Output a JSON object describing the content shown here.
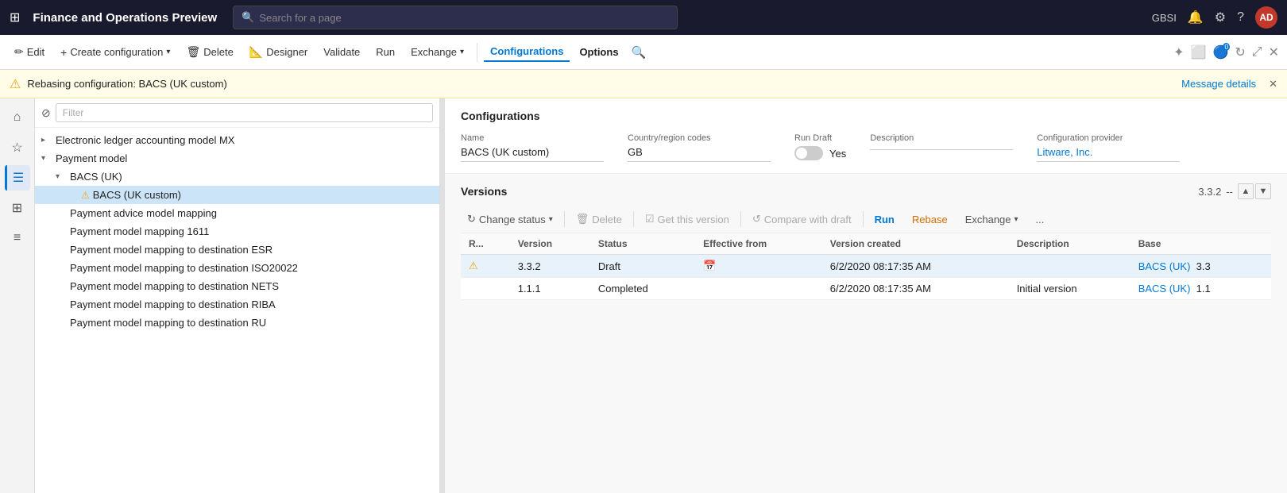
{
  "topNav": {
    "appTitle": "Finance and Operations Preview",
    "searchPlaceholder": "Search for a page",
    "userInitials": "AD",
    "gbsiLabel": "GBSI"
  },
  "actionBar": {
    "editLabel": "Edit",
    "createConfigLabel": "Create configuration",
    "deleteLabel": "Delete",
    "designerLabel": "Designer",
    "validateLabel": "Validate",
    "runLabel": "Run",
    "exchangeLabel": "Exchange",
    "configurationsLabel": "Configurations",
    "optionsLabel": "Options"
  },
  "warningBar": {
    "message": "Rebasing configuration: BACS (UK custom)",
    "messageDetailsLabel": "Message details"
  },
  "leftPanel": {
    "filterPlaceholder": "Filter",
    "treeItems": [
      {
        "id": "electronic",
        "label": "Electronic ledger accounting model MX",
        "level": 0,
        "hasChevron": true,
        "chevronDir": "right"
      },
      {
        "id": "payment-model",
        "label": "Payment model",
        "level": 0,
        "hasChevron": true,
        "chevronDir": "down"
      },
      {
        "id": "bacs-uk",
        "label": "BACS (UK)",
        "level": 1,
        "hasChevron": true,
        "chevronDir": "down"
      },
      {
        "id": "bacs-uk-custom",
        "label": "BACS (UK custom)",
        "level": 2,
        "hasChevron": false,
        "selected": true,
        "hasWarning": true
      },
      {
        "id": "payment-advice",
        "label": "Payment advice model mapping",
        "level": 1,
        "hasChevron": false
      },
      {
        "id": "payment-mapping-1611",
        "label": "Payment model mapping 1611",
        "level": 1,
        "hasChevron": false
      },
      {
        "id": "payment-dest-esr",
        "label": "Payment model mapping to destination ESR",
        "level": 1,
        "hasChevron": false
      },
      {
        "id": "payment-dest-iso",
        "label": "Payment model mapping to destination ISO20022",
        "level": 1,
        "hasChevron": false
      },
      {
        "id": "payment-dest-nets",
        "label": "Payment model mapping to destination NETS",
        "level": 1,
        "hasChevron": false
      },
      {
        "id": "payment-dest-riba",
        "label": "Payment model mapping to destination RIBA",
        "level": 1,
        "hasChevron": false
      },
      {
        "id": "payment-dest-ru",
        "label": "Payment model mapping to destination RU",
        "level": 1,
        "hasChevron": false
      }
    ]
  },
  "rightPanel": {
    "configSectionTitle": "Configurations",
    "nameLabel": "Name",
    "nameValue": "BACS (UK custom)",
    "countryLabel": "Country/region codes",
    "countryValue": "GB",
    "runDraftLabel": "Run Draft",
    "runDraftValue": "Yes",
    "descriptionLabel": "Description",
    "configProviderLabel": "Configuration provider",
    "configProviderValue": "Litware, Inc.",
    "versionsSectionTitle": "Versions",
    "currentVersion": "3.3.2",
    "versionDash": "--",
    "toolbar": {
      "changeStatusLabel": "Change status",
      "deleteLabel": "Delete",
      "getThisVersionLabel": "Get this version",
      "compareWithDraftLabel": "Compare with draft",
      "runLabel": "Run",
      "rebaseLabel": "Rebase",
      "exchangeLabel": "Exchange",
      "moreLabel": "..."
    },
    "tableColumns": [
      "R...",
      "Version",
      "Status",
      "Effective from",
      "Version created",
      "Description",
      "Base"
    ],
    "tableRows": [
      {
        "rFlag": "⚠",
        "version": "3.3.2",
        "status": "Draft",
        "effectiveFrom": "",
        "versionCreated": "6/2/2020 08:17:35 AM",
        "description": "",
        "base": "BACS (UK)",
        "baseVersion": "3.3",
        "selected": true,
        "hasCalendar": true,
        "hasWarning": true
      },
      {
        "rFlag": "",
        "version": "1.1.1",
        "status": "Completed",
        "effectiveFrom": "",
        "versionCreated": "6/2/2020 08:17:35 AM",
        "description": "Initial version",
        "base": "BACS (UK)",
        "baseVersion": "1.1",
        "selected": false,
        "hasCalendar": false,
        "hasWarning": false
      }
    ]
  }
}
